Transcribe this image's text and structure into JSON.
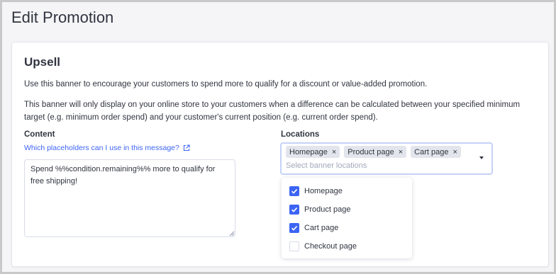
{
  "page": {
    "title": "Edit Promotion"
  },
  "card": {
    "title": "Upsell",
    "description_1": "Use this banner to encourage your customers to spend more to qualify for a discount or value-added promotion.",
    "description_2": "This banner will only display on your online store to your customers when a difference can be calculated between your specified minimum target (e.g. minimum order spend) and your customer's current position (e.g. current order spend)."
  },
  "content": {
    "label": "Content",
    "help_link": "Which placeholders can I use in this message?",
    "message": "Spend %%condition.remaining%% more to qualify for free shipping!"
  },
  "locations": {
    "label": "Locations",
    "placeholder": "Select banner locations",
    "selected_tags": [
      {
        "label": "Homepage",
        "remove": "×"
      },
      {
        "label": "Product page",
        "remove": "×"
      },
      {
        "label": "Cart page",
        "remove": "×"
      }
    ],
    "options": [
      {
        "label": "Homepage",
        "checked": true
      },
      {
        "label": "Product page",
        "checked": true
      },
      {
        "label": "Cart page",
        "checked": true
      },
      {
        "label": "Checkout page",
        "checked": false
      }
    ]
  },
  "colors": {
    "accent": "#3c64f4",
    "text": "#313440",
    "tag_bg": "#e3e5ec",
    "focus_border": "#c5d2f6"
  }
}
